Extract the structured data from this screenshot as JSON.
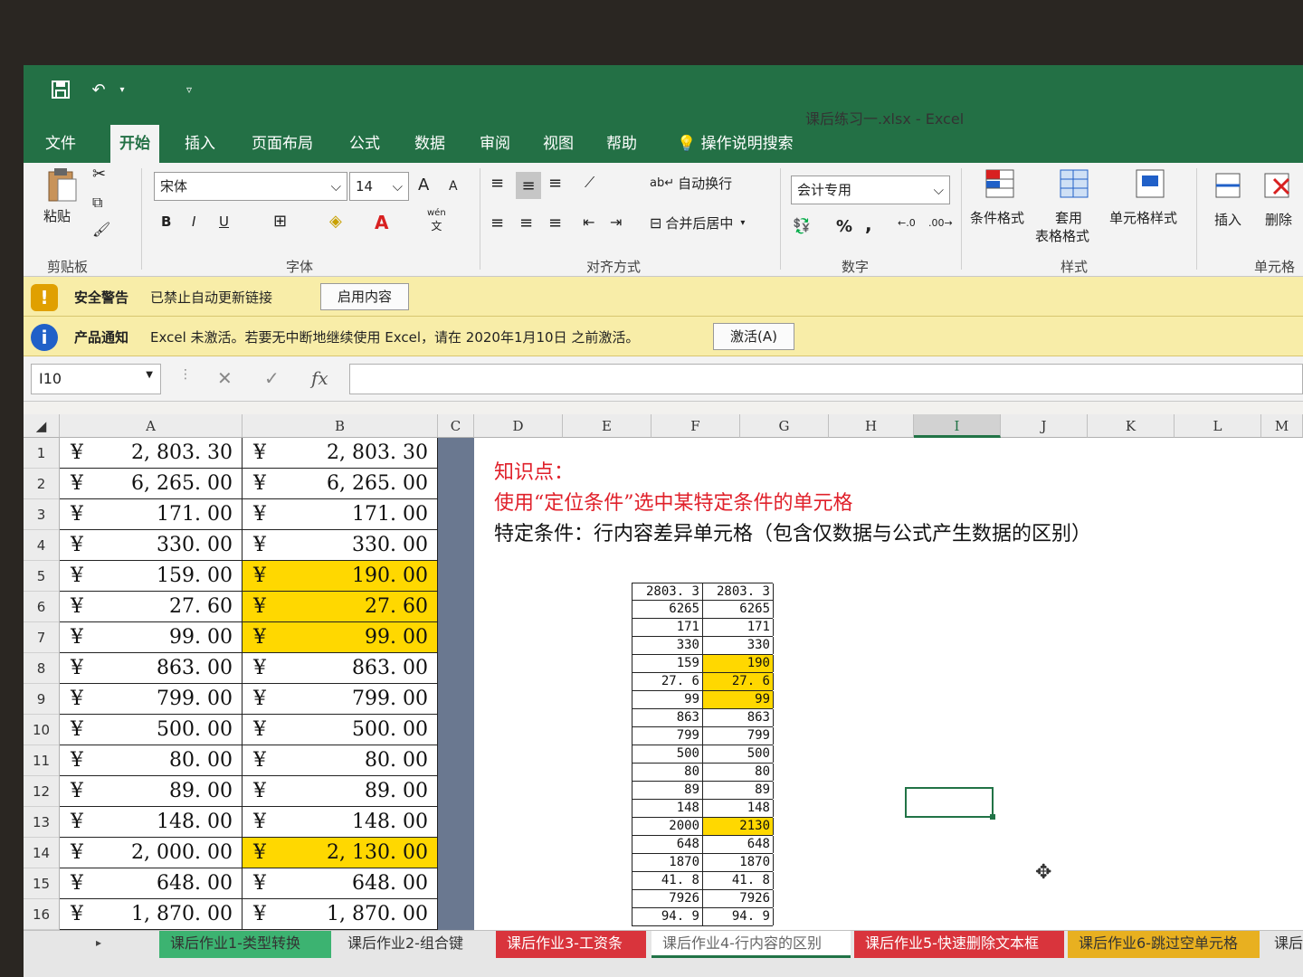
{
  "window": {
    "doc_title": "课后练习一.xlsx  -  Excel"
  },
  "qat": {
    "save_icon": "save-icon",
    "undo_icon": "undo-icon",
    "customize_icon": "customize-icon"
  },
  "tabs": [
    {
      "label": "文件",
      "active": false
    },
    {
      "label": "开始",
      "active": true
    },
    {
      "label": "插入",
      "active": false
    },
    {
      "label": "页面布局",
      "active": false
    },
    {
      "label": "公式",
      "active": false
    },
    {
      "label": "数据",
      "active": false
    },
    {
      "label": "审阅",
      "active": false
    },
    {
      "label": "视图",
      "active": false
    },
    {
      "label": "帮助",
      "active": false
    }
  ],
  "tell_me": "操作说明搜索",
  "ribbon": {
    "clipboard": {
      "paste": "粘贴",
      "label": "剪贴板"
    },
    "font": {
      "name": "宋体",
      "size": "14",
      "label": "字体",
      "bold": "B",
      "italic": "I",
      "underline": "U",
      "grow": "A",
      "shrink": "A",
      "wen": "wén",
      "wen_char": "文",
      "fontcolor": "A"
    },
    "align": {
      "wrap": "自动换行",
      "merge": "合并后居中",
      "label": "对齐方式"
    },
    "number": {
      "format": "会计专用",
      "label": "数字",
      "percent": "%",
      "comma": ","
    },
    "styles": {
      "cond": "条件格式",
      "table": "套用",
      "table2": "表格格式",
      "cellstyle": "单元格样式",
      "label": "样式"
    },
    "cells": {
      "insert": "插入",
      "delete": "删除",
      "label": "单元格"
    }
  },
  "security_bar": {
    "title": "安全警告",
    "text": "已禁止自动更新链接",
    "button": "启用内容"
  },
  "notice_bar": {
    "title": "产品通知",
    "text": "Excel 未激活。若要无中断地继续使用 Excel，请在 2020年1月10日 之前激活。",
    "button": "激活(A)"
  },
  "formula_bar": {
    "name_box": "I10",
    "cancel": "✕",
    "enter": "✓",
    "fx": "fx",
    "content": ""
  },
  "columns": [
    "A",
    "B",
    "C",
    "D",
    "E",
    "F",
    "G",
    "H",
    "I",
    "J",
    "K",
    "L",
    "M"
  ],
  "rows": [
    {
      "n": "1",
      "a": "2, 803. 30",
      "b": "2, 803. 30",
      "hl": false
    },
    {
      "n": "2",
      "a": "6, 265. 00",
      "b": "6, 265. 00",
      "hl": false
    },
    {
      "n": "3",
      "a": "171. 00",
      "b": "171. 00",
      "hl": false
    },
    {
      "n": "4",
      "a": "330. 00",
      "b": "330. 00",
      "hl": false
    },
    {
      "n": "5",
      "a": "159. 00",
      "b": "190. 00",
      "hl": true
    },
    {
      "n": "6",
      "a": "27. 60",
      "b": "27. 60",
      "hl": true
    },
    {
      "n": "7",
      "a": "99. 00",
      "b": "99. 00",
      "hl": true
    },
    {
      "n": "8",
      "a": "863. 00",
      "b": "863. 00",
      "hl": false
    },
    {
      "n": "9",
      "a": "799. 00",
      "b": "799. 00",
      "hl": false
    },
    {
      "n": "10",
      "a": "500. 00",
      "b": "500. 00",
      "hl": false
    },
    {
      "n": "11",
      "a": "80. 00",
      "b": "80. 00",
      "hl": false
    },
    {
      "n": "12",
      "a": "89. 00",
      "b": "89. 00",
      "hl": false
    },
    {
      "n": "13",
      "a": "148. 00",
      "b": "148. 00",
      "hl": false
    },
    {
      "n": "14",
      "a": "2, 000. 00",
      "b": "2, 130. 00",
      "hl": true
    },
    {
      "n": "15",
      "a": "648. 00",
      "b": "648. 00",
      "hl": false
    },
    {
      "n": "16",
      "a": "1, 870. 00",
      "b": "1, 870. 00",
      "hl": false
    }
  ],
  "currency": "¥",
  "notes": {
    "line1": "知识点：",
    "line2": "使用“定位条件”选中某特定条件的单元格",
    "line3": "特定条件：行内容差异单元格（包含仅数据与公式产生数据的区别）",
    "red": "#e0202a"
  },
  "mini_table": [
    [
      "2803. 3",
      "2803. 3",
      false
    ],
    [
      "6265",
      "6265",
      false
    ],
    [
      "171",
      "171",
      false
    ],
    [
      "330",
      "330",
      false
    ],
    [
      "159",
      "190",
      true
    ],
    [
      "27. 6",
      "27. 6",
      true
    ],
    [
      "99",
      "99",
      true
    ],
    [
      "863",
      "863",
      false
    ],
    [
      "799",
      "799",
      false
    ],
    [
      "500",
      "500",
      false
    ],
    [
      "80",
      "80",
      false
    ],
    [
      "89",
      "89",
      false
    ],
    [
      "148",
      "148",
      false
    ],
    [
      "2000",
      "2130",
      true
    ],
    [
      "648",
      "648",
      false
    ],
    [
      "1870",
      "1870",
      false
    ],
    [
      "41. 8",
      "41. 8",
      false
    ],
    [
      "7926",
      "7926",
      false
    ],
    [
      "94. 9",
      "94. 9",
      false
    ]
  ],
  "sheets": [
    {
      "label": "课后作业1-类型转换",
      "color": "#3cb371"
    },
    {
      "label": "课后作业2-组合键",
      "color": "#e6e6e6"
    },
    {
      "label": "课后作业3-工资条",
      "color": "#d9343c"
    },
    {
      "label": "课后作业4-行内容的区别",
      "color": "#ffffff"
    },
    {
      "label": "课后作业5-快速删除文本框",
      "color": "#d9343c"
    },
    {
      "label": "课后作业6-跳过空单元格",
      "color": "#e8b020"
    },
    {
      "label": "课后",
      "color": "#e6e6e6"
    }
  ]
}
